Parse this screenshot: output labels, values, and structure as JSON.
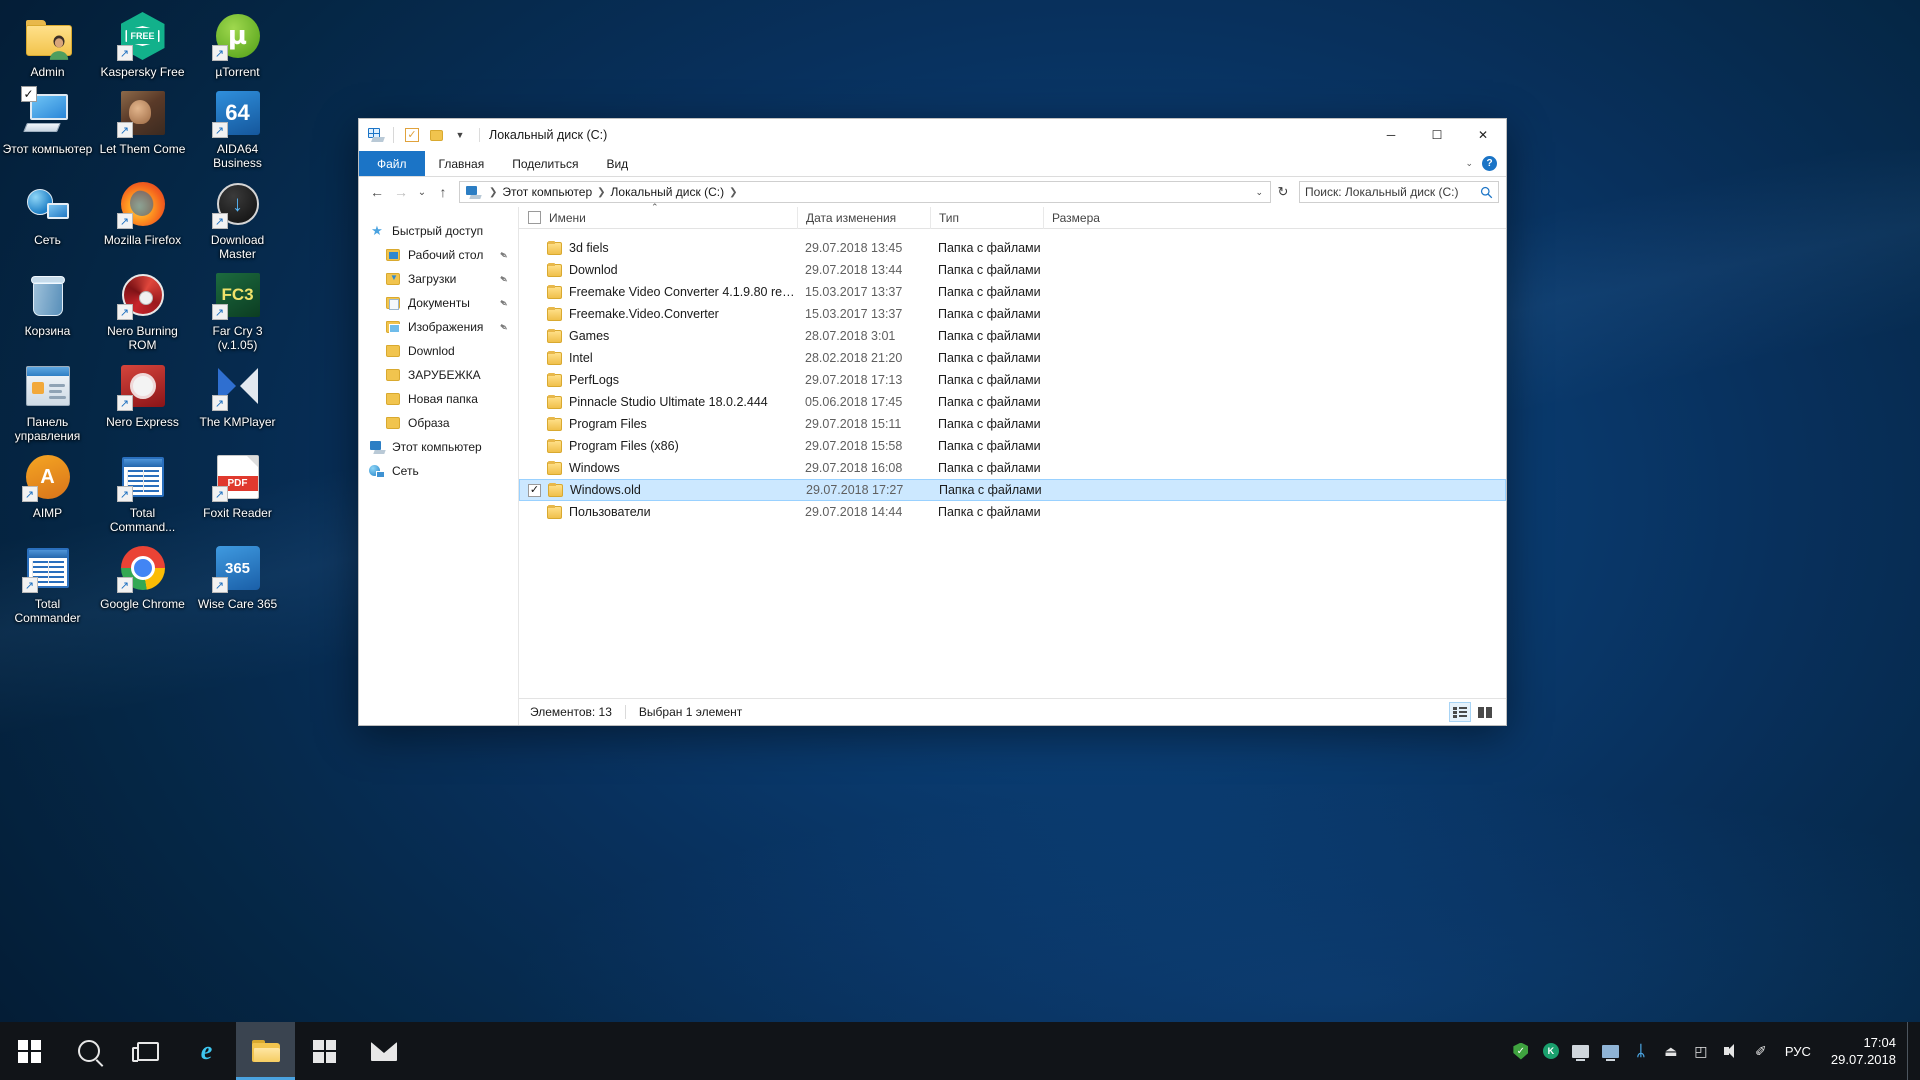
{
  "desktop": {
    "icons": [
      {
        "label": "Admin",
        "icon": "user-folder-icon",
        "shortcut": false,
        "checked": false
      },
      {
        "label": "Kaspersky Free",
        "icon": "kaspersky-shield-icon",
        "shortcut": true,
        "checked": false,
        "badge": "FREE"
      },
      {
        "label": "µTorrent",
        "icon": "utorrent-icon",
        "shortcut": true,
        "checked": false,
        "badge": "μ"
      },
      {
        "label": "Этот компьютер",
        "icon": "this-pc-icon",
        "shortcut": false,
        "checked": true
      },
      {
        "label": "Let Them Come",
        "icon": "game-artwork-icon",
        "shortcut": true,
        "checked": false
      },
      {
        "label": "AIDA64 Business",
        "icon": "aida64-icon",
        "shortcut": true,
        "checked": false,
        "badge": "64"
      },
      {
        "label": "Сеть",
        "icon": "network-icon",
        "shortcut": false,
        "checked": false
      },
      {
        "label": "Mozilla Firefox",
        "icon": "firefox-icon",
        "shortcut": true,
        "checked": false
      },
      {
        "label": "Download Master",
        "icon": "download-master-icon",
        "shortcut": true,
        "checked": false,
        "badge": "↓"
      },
      {
        "label": "Корзина",
        "icon": "recycle-bin-icon",
        "shortcut": false,
        "checked": false
      },
      {
        "label": "Nero Burning ROM",
        "icon": "nero-burning-rom-icon",
        "shortcut": true,
        "checked": false
      },
      {
        "label": "Far Cry 3 (v.1.05)",
        "icon": "far-cry-3-icon",
        "shortcut": true,
        "checked": false,
        "badge": "FC3"
      },
      {
        "label": "Панель управления",
        "icon": "control-panel-icon",
        "shortcut": false,
        "checked": false
      },
      {
        "label": "Nero Express",
        "icon": "nero-express-icon",
        "shortcut": true,
        "checked": false
      },
      {
        "label": "The KMPlayer",
        "icon": "kmplayer-icon",
        "shortcut": true,
        "checked": false
      },
      {
        "label": "AIMP",
        "icon": "aimp-icon",
        "shortcut": true,
        "checked": false,
        "badge": "A"
      },
      {
        "label": "Total Command...",
        "icon": "total-commander-icon",
        "shortcut": true,
        "checked": false
      },
      {
        "label": "Foxit Reader",
        "icon": "foxit-reader-icon",
        "shortcut": true,
        "checked": false,
        "badge": "PDF"
      },
      {
        "label": "Total Commander",
        "icon": "total-commander-icon",
        "shortcut": true,
        "checked": false
      },
      {
        "label": "Google Chrome",
        "icon": "google-chrome-icon",
        "shortcut": true,
        "checked": false
      },
      {
        "label": "Wise Care 365",
        "icon": "wise-care-365-icon",
        "shortcut": true,
        "checked": false,
        "badge": "365"
      }
    ]
  },
  "window": {
    "title": "Локальный диск (C:)",
    "quick_access_icons": [
      "this-pc-icon",
      "properties-checkbox-icon",
      "new-folder-icon",
      "customize-caret-icon"
    ],
    "controls": {
      "minimize": "─",
      "maximize": "☐",
      "close": "✕"
    }
  },
  "ribbon": {
    "tabs": [
      {
        "label": "Файл",
        "active": true
      },
      {
        "label": "Главная",
        "active": false
      },
      {
        "label": "Поделиться",
        "active": false
      },
      {
        "label": "Вид",
        "active": false
      }
    ],
    "collapse_caret": "⌄",
    "help_label": "?"
  },
  "navigation": {
    "back": "←",
    "forward": "→",
    "recent": "⌄",
    "up": "↑",
    "breadcrumb": [
      "Этот компьютер",
      "Локальный диск (C:)"
    ],
    "dropdown_caret": "⌄",
    "refresh": "↻"
  },
  "search": {
    "placeholder": "Поиск: Локальный диск (C:)",
    "value": "",
    "icon": "search-icon"
  },
  "sidebar": {
    "items": [
      {
        "label": "Быстрый доступ",
        "icon": "star-icon",
        "indent": false,
        "pinned": false
      },
      {
        "label": "Рабочий стол",
        "icon": "desktop-folder-icon",
        "indent": true,
        "pinned": true
      },
      {
        "label": "Загрузки",
        "icon": "downloads-folder-icon",
        "indent": true,
        "pinned": true
      },
      {
        "label": "Документы",
        "icon": "documents-folder-icon",
        "indent": true,
        "pinned": true
      },
      {
        "label": "Изображения",
        "icon": "pictures-folder-icon",
        "indent": true,
        "pinned": true
      },
      {
        "label": "Downlod",
        "icon": "folder-icon",
        "indent": true,
        "pinned": false
      },
      {
        "label": "ЗАРУБЕЖКА",
        "icon": "folder-icon",
        "indent": true,
        "pinned": false
      },
      {
        "label": "Новая папка",
        "icon": "folder-icon",
        "indent": true,
        "pinned": false
      },
      {
        "label": "Образа",
        "icon": "folder-icon",
        "indent": true,
        "pinned": false
      },
      {
        "label": "Этот компьютер",
        "icon": "this-pc-icon",
        "indent": false,
        "pinned": false
      },
      {
        "label": "Сеть",
        "icon": "network-icon",
        "indent": false,
        "pinned": false
      }
    ],
    "pin_glyph": "✒"
  },
  "file_list": {
    "columns": [
      {
        "key": "name",
        "label": "Имени",
        "sorted": true
      },
      {
        "key": "date",
        "label": "Дата изменения",
        "sorted": false
      },
      {
        "key": "type",
        "label": "Тип",
        "sorted": false
      },
      {
        "key": "size",
        "label": "Размера",
        "sorted": false
      }
    ],
    "sort_glyph": "⌃",
    "rows": [
      {
        "name": "3d fiels",
        "date": "29.07.2018 13:45",
        "type": "Папка с файлами",
        "size": "",
        "selected": false,
        "checked": false
      },
      {
        "name": "Downlod",
        "date": "29.07.2018 13:44",
        "type": "Папка с файлами",
        "size": "",
        "selected": false,
        "checked": false
      },
      {
        "name": "Freemake Video Converter 4.1.9.80 rep...",
        "date": "15.03.2017 13:37",
        "type": "Папка с файлами",
        "size": "",
        "selected": false,
        "checked": false
      },
      {
        "name": "Freemake.Video.Converter",
        "date": "15.03.2017 13:37",
        "type": "Папка с файлами",
        "size": "",
        "selected": false,
        "checked": false
      },
      {
        "name": "Games",
        "date": "28.07.2018 3:01",
        "type": "Папка с файлами",
        "size": "",
        "selected": false,
        "checked": false
      },
      {
        "name": "Intel",
        "date": "28.02.2018 21:20",
        "type": "Папка с файлами",
        "size": "",
        "selected": false,
        "checked": false
      },
      {
        "name": "PerfLogs",
        "date": "29.07.2018 17:13",
        "type": "Папка с файлами",
        "size": "",
        "selected": false,
        "checked": false
      },
      {
        "name": "Pinnacle Studio Ultimate 18.0.2.444",
        "date": "05.06.2018 17:45",
        "type": "Папка с файлами",
        "size": "",
        "selected": false,
        "checked": false
      },
      {
        "name": "Program Files",
        "date": "29.07.2018 15:11",
        "type": "Папка с файлами",
        "size": "",
        "selected": false,
        "checked": false
      },
      {
        "name": "Program Files (x86)",
        "date": "29.07.2018 15:58",
        "type": "Папка с файлами",
        "size": "",
        "selected": false,
        "checked": false
      },
      {
        "name": "Windows",
        "date": "29.07.2018 16:08",
        "type": "Папка с файлами",
        "size": "",
        "selected": false,
        "checked": false
      },
      {
        "name": "Windows.old",
        "date": "29.07.2018 17:27",
        "type": "Папка с файлами",
        "size": "",
        "selected": true,
        "checked": true
      },
      {
        "name": "Пользователи",
        "date": "29.07.2018 14:44",
        "type": "Папка с файлами",
        "size": "",
        "selected": false,
        "checked": false
      }
    ]
  },
  "statusbar": {
    "item_count": "Элементов: 13",
    "selection": "Выбран 1 элемент",
    "view_details": "details-view-icon",
    "view_large": "large-icons-view-icon"
  },
  "taskbar": {
    "start": "windows-logo-icon",
    "buttons": [
      {
        "name": "search-icon",
        "active": false
      },
      {
        "name": "task-view-icon",
        "active": false
      },
      {
        "name": "edge-icon",
        "active": false,
        "glyph": "e"
      },
      {
        "name": "file-explorer-icon",
        "active": true
      },
      {
        "name": "microsoft-store-icon",
        "active": false
      },
      {
        "name": "mail-icon",
        "active": false
      }
    ],
    "tray": [
      {
        "name": "security-shield-icon",
        "glyph": "✓"
      },
      {
        "name": "kaspersky-tray-icon",
        "glyph": "K"
      },
      {
        "name": "monitor-tray-icon",
        "glyph": ""
      },
      {
        "name": "display-settings-icon",
        "glyph": ""
      },
      {
        "name": "bluetooth-icon",
        "glyph": "ᛦ"
      },
      {
        "name": "usb-eject-icon",
        "glyph": "⏏"
      },
      {
        "name": "network-icon",
        "glyph": "◰"
      },
      {
        "name": "volume-icon",
        "glyph": ""
      },
      {
        "name": "pen-settings-icon",
        "glyph": "✐"
      }
    ],
    "language": "РУС",
    "clock_time": "17:04",
    "clock_date": "29.07.2018",
    "show_desktop": "show-desktop-button"
  }
}
